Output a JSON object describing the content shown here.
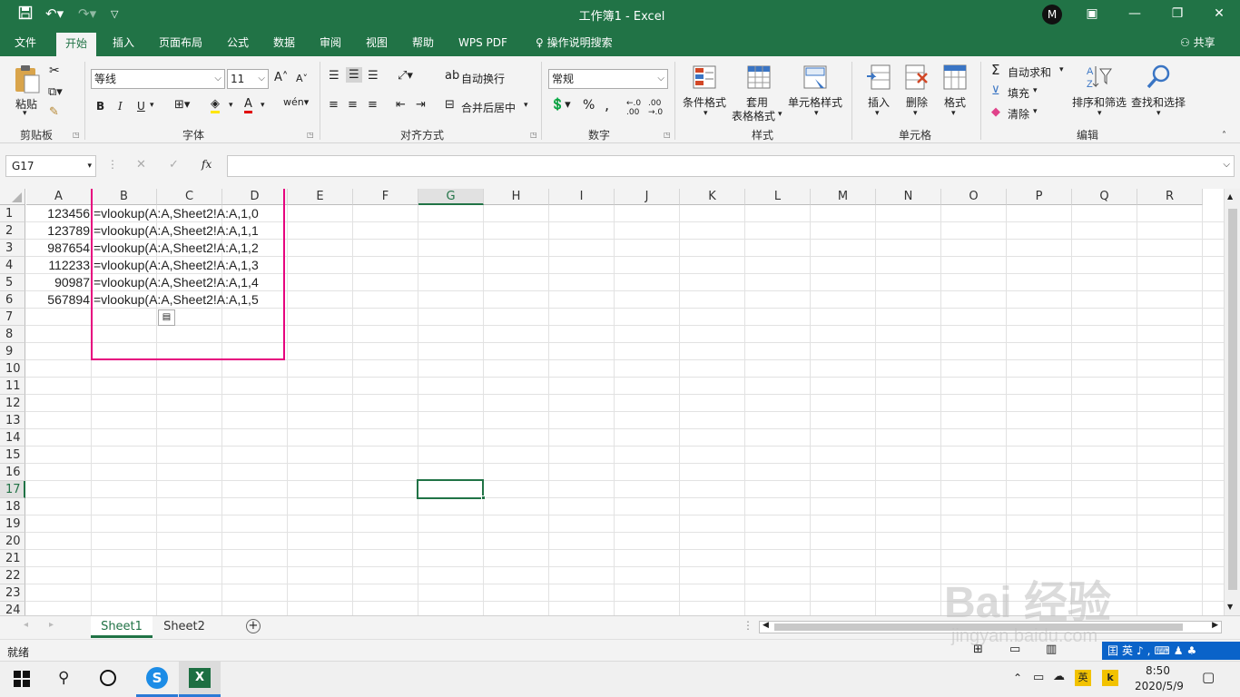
{
  "colors": {
    "brand": "#217346",
    "highlight": "#e6007e",
    "selection": "#217346"
  },
  "titlebar": {
    "title": "工作簿1  -  Excel"
  },
  "tabs": [
    "文件",
    "开始",
    "插入",
    "页面布局",
    "公式",
    "数据",
    "审阅",
    "视图",
    "帮助",
    "WPS PDF"
  ],
  "search_label": "操作说明搜索",
  "share_label": "共享",
  "ribbon": {
    "paste": "粘贴",
    "clipboard": "剪贴板",
    "font_name": "等线",
    "font_size": "11",
    "bold": "B",
    "italic": "I",
    "underline": "U",
    "font_group": "字体",
    "wrap": "自动换行",
    "merge": "合并后居中",
    "align_group": "对齐方式",
    "number_format": "常规",
    "percent": "%",
    "comma": ",",
    "number_group": "数字",
    "cond_format": "条件格式",
    "table_format_1": "套用",
    "table_format_2": "表格格式",
    "cell_styles": "单元格样式",
    "styles_group": "样式",
    "insert": "插入",
    "delete": "删除",
    "format": "格式",
    "cells_group": "单元格",
    "autosum": "自动求和",
    "fill": "填充",
    "clear": "清除",
    "sort_filter": "排序和筛选",
    "find_select": "查找和选择",
    "editing_group": "编辑"
  },
  "formula_bar": {
    "name_box": "G17",
    "fx": "fx",
    "value": ""
  },
  "columns": [
    "A",
    "B",
    "C",
    "D",
    "E",
    "F",
    "G",
    "H",
    "I",
    "J",
    "K",
    "L",
    "M",
    "N",
    "O",
    "P",
    "Q",
    "R"
  ],
  "rows": [
    "1",
    "2",
    "3",
    "4",
    "5",
    "6",
    "7",
    "8",
    "9",
    "10",
    "11",
    "12",
    "13",
    "14",
    "15",
    "16",
    "17",
    "18",
    "19",
    "20",
    "21",
    "22",
    "23",
    "24"
  ],
  "cells": {
    "A": [
      "123456",
      "123789",
      "987654",
      "112233",
      "90987",
      "567894"
    ],
    "B": [
      "=vlookup(A:A,Sheet2!A:A,1,0",
      "=vlookup(A:A,Sheet2!A:A,1,1",
      "=vlookup(A:A,Sheet2!A:A,1,2",
      "=vlookup(A:A,Sheet2!A:A,1,3",
      "=vlookup(A:A,Sheet2!A:A,1,4",
      "=vlookup(A:A,Sheet2!A:A,1,5"
    ]
  },
  "sheets": [
    "Sheet1",
    "Sheet2"
  ],
  "status": {
    "ready": "就绪"
  },
  "watermark": {
    "brand": "Bai 经验",
    "url": "jingyan.baidu.com"
  },
  "tray": {
    "ime": "英",
    "time": "8:50",
    "date": "2020/5/9"
  }
}
